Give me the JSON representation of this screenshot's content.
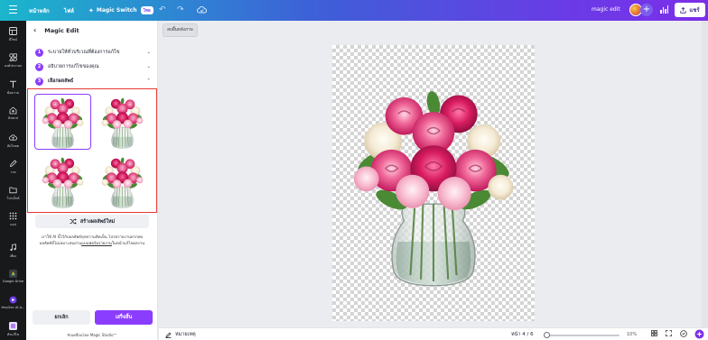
{
  "topbar": {
    "home": "หน้าหลัก",
    "file": "ไฟล์",
    "magic_switch": "Magic Switch",
    "magic_switch_badge": "โทล",
    "design_title": "magic edit",
    "share": "แชร์"
  },
  "rail": {
    "items": [
      {
        "label": "ดีไซน์",
        "icon": "layout-icon"
      },
      {
        "label": "องค์ประกอบ",
        "icon": "elements-icon"
      },
      {
        "label": "ข้อความ",
        "icon": "text-icon"
      },
      {
        "label": "Brand",
        "icon": "brand-icon"
      },
      {
        "label": "อัปโหลด",
        "icon": "upload-icon"
      },
      {
        "label": "วาด",
        "icon": "draw-icon"
      },
      {
        "label": "โปรเจ็กต์",
        "icon": "folder-icon"
      },
      {
        "label": "แอป",
        "icon": "apps-icon"
      },
      {
        "label": "เสียง",
        "icon": "music-icon"
      },
      {
        "label": "Google Drive",
        "icon": "google-drive-icon"
      },
      {
        "label": "HeyGen AI A...",
        "icon": "heygen-icon"
      },
      {
        "label": "ตัวแก้ไข",
        "icon": "app-icon"
      }
    ]
  },
  "panel": {
    "title": "Magic Edit",
    "steps": [
      {
        "num": "1",
        "label": "ระบายให้ทั่วบริเวณที่ต้องการแก้ไข"
      },
      {
        "num": "2",
        "label": "อธิบายการแก้ไขของคุณ"
      },
      {
        "num": "3",
        "label": "เลือกผลลัพธ์"
      }
    ],
    "regenerate": "สร้างผลลัพธ์ใหม่",
    "note_part1": "เราใช้ AI นี้ไว้กับผลลัพธ์ทุกความคิดเห็น โปรดรายงานหากพบผลลัพธ์ที่ไม่เหมาะสมผ่าน",
    "note_link": "แบบฟอร์มรายงาน",
    "note_part2": "ในหน้าแก้ไขผลงาน",
    "cancel": "ยกเลิก",
    "done": "เสร็จสิ้น",
    "powered": "ขับเคลื่อนโดย Magic Studio™"
  },
  "canvas": {
    "context_chip": "ลบพื้นหลังภาพ"
  },
  "bottombar": {
    "notes": "หมายเหตุ",
    "page": "หน้า 4 / 6",
    "zoom": "10%"
  },
  "colors": {
    "accent": "#8b3dff",
    "highlight_border": "#e53935",
    "rail_bg": "#18191b"
  }
}
